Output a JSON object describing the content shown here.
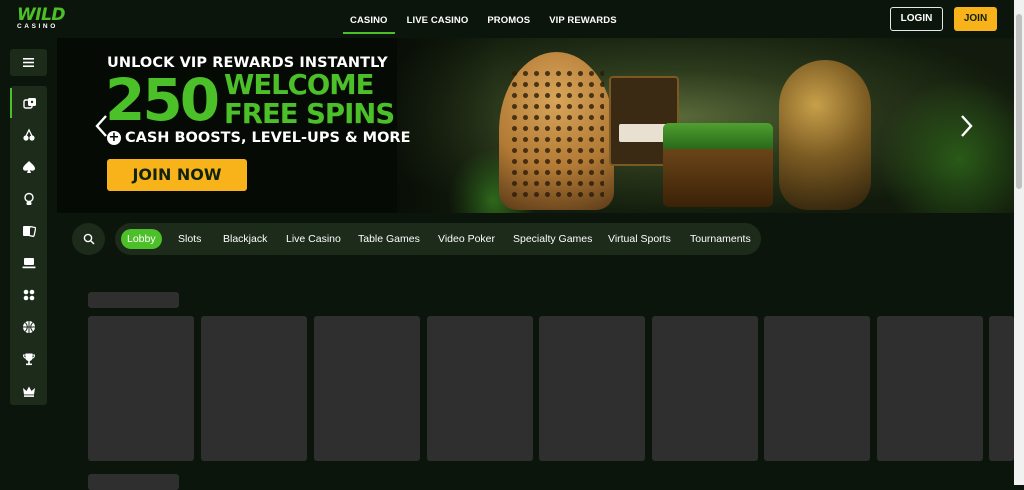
{
  "brand": {
    "logo_top": "WILD",
    "logo_bottom": "CASINO"
  },
  "topnav": {
    "items": [
      {
        "label": "CASINO",
        "active": true
      },
      {
        "label": "LIVE CASINO"
      },
      {
        "label": "PROMOS"
      },
      {
        "label": "VIP REWARDS"
      }
    ]
  },
  "auth": {
    "login_label": "LOGIN",
    "join_label": "JOIN"
  },
  "sidebar": {
    "items": [
      {
        "icon": "casino-chips-icon",
        "active": true
      },
      {
        "icon": "slots-cherry-icon"
      },
      {
        "icon": "spade-icon"
      },
      {
        "icon": "dealer-icon"
      },
      {
        "icon": "cards-icon"
      },
      {
        "icon": "video-poker-icon"
      },
      {
        "icon": "dice-icon"
      },
      {
        "icon": "basketball-icon"
      },
      {
        "icon": "trophy-icon"
      },
      {
        "icon": "crown-icon"
      }
    ]
  },
  "hero": {
    "line1": "UNLOCK VIP REWARDS INSTANTLY",
    "number": "250",
    "welcome": "WELCOME",
    "free_spins": "FREE SPINS",
    "line4": "CASH BOOSTS, LEVEL-UPS & MORE",
    "cta": "JOIN NOW"
  },
  "filters": {
    "items": [
      {
        "label": "Lobby",
        "active": true
      },
      {
        "label": "Slots"
      },
      {
        "label": "Blackjack"
      },
      {
        "label": "Live Casino"
      },
      {
        "label": "Table Games"
      },
      {
        "label": "Video Poker"
      },
      {
        "label": "Specialty Games"
      },
      {
        "label": "Virtual Sports"
      },
      {
        "label": "Tournaments"
      }
    ]
  },
  "colors": {
    "accent": "#4cc028",
    "cta": "#f8b31b",
    "panel": "#1c2b1a",
    "skeleton": "#2f2f2f",
    "background": "#0c150b"
  }
}
